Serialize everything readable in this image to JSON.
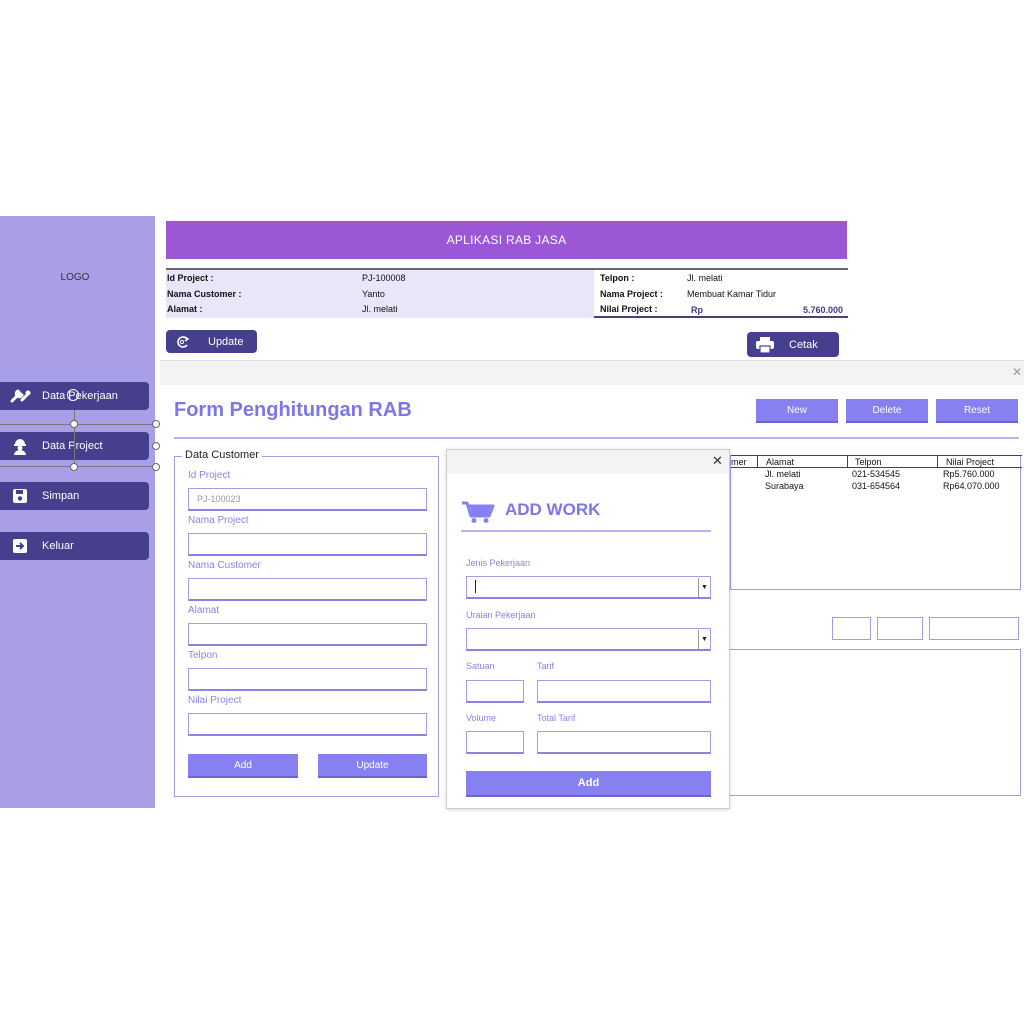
{
  "sidebar": {
    "logo": "LOGO",
    "items": [
      {
        "label": "Data Pekerjaan",
        "icon": "tools-icon"
      },
      {
        "label": "Data Project",
        "icon": "worker-icon"
      },
      {
        "label": "Simpan",
        "icon": "save-icon"
      },
      {
        "label": "Keluar",
        "icon": "exit-icon"
      }
    ]
  },
  "header": {
    "title": "APLIKASI RAB JASA",
    "info": {
      "id_project_label": "Id Project :",
      "id_project_value": "PJ-100008",
      "nama_customer_label": "Nama Customer :",
      "nama_customer_value": "Yanto",
      "alamat_label": "Alamat :",
      "alamat_value": "Jl. melati",
      "telpon_label": "Telpon :",
      "telpon_value": "Jl. melati",
      "nama_project_label": "Nama Project :",
      "nama_project_value": "Membuat Kamar Tidur",
      "nilai_project_label": "Nilai Project :",
      "nilai_currency": "Rp",
      "nilai_project_value": "5.760.000"
    },
    "update_label": "Update",
    "cetak_label": "Cetak"
  },
  "form": {
    "title": "Form Penghitungan RAB",
    "buttons": {
      "new": "New",
      "delete": "Delete",
      "reset": "Reset"
    },
    "group_title": "Data Customer",
    "fields": {
      "id_project_label": "Id Project",
      "id_project_value": "PJ-100023",
      "nama_project_label": "Nama Project",
      "nama_customer_label": "Nama Customer",
      "alamat_label": "Alamat",
      "telpon_label": "Telpon",
      "nilai_project_label": "Nilai Project"
    },
    "add_label": "Add",
    "update_label": "Update",
    "close": "✕"
  },
  "table": {
    "columns": [
      "mer",
      "Alamat",
      "Telpon",
      "Nilai Project"
    ],
    "rows": [
      {
        "alamat": "Jl. melati",
        "telpon": "021-534545",
        "nilai": "Rp5.760.000"
      },
      {
        "alamat": "Surabaya",
        "telpon": "031-654564",
        "nilai": "Rp64.070.000"
      }
    ]
  },
  "modal": {
    "title": "ADD WORK",
    "close": "✕",
    "jenis_label": "Jenis Pekerjaan",
    "uraian_label": "Uraian Pekerjaan",
    "satuan_label": "Satuan",
    "tarif_label": "Tarif",
    "volume_label": "Volume",
    "total_tarif_label": "Total Tarif",
    "add_label": "Add"
  },
  "colors": {
    "sidebar": "#a99fe9",
    "nav_button": "#463f8e",
    "banner": "#9b57d6",
    "accent": "#8680f1",
    "title_text": "#7d76e8"
  }
}
